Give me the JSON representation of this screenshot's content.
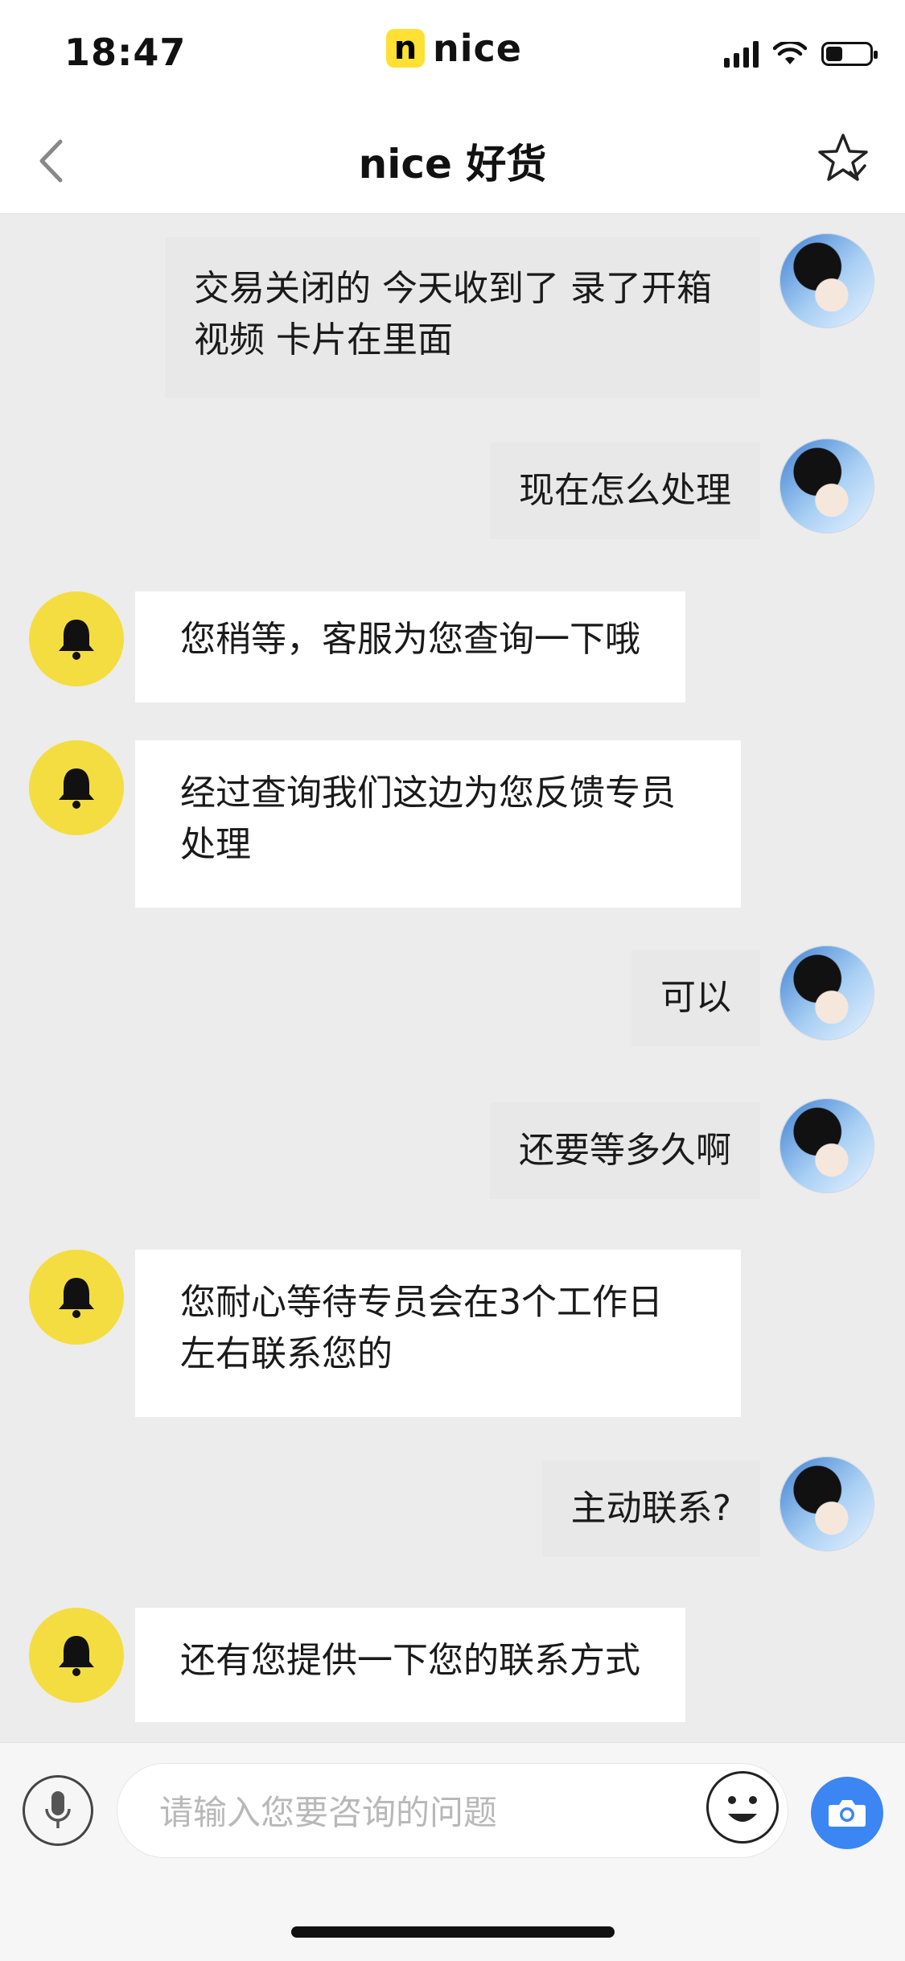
{
  "status_bar": {
    "time": "18:47",
    "brand_badge": "n",
    "brand_name": "nice"
  },
  "nav": {
    "title": "nice 好货",
    "back_icon": "chevron-left-icon",
    "star_icon": "star-icon"
  },
  "messages": [
    {
      "sender": "user",
      "text": "交易关闭的 今天收到了 录了开箱视频 卡片在里面"
    },
    {
      "sender": "user",
      "text": "现在怎么处理"
    },
    {
      "sender": "bot",
      "text": "您稍等，客服为您查询一下哦"
    },
    {
      "sender": "bot",
      "text": "经过查询我们这边为您反馈专员处理"
    },
    {
      "sender": "user",
      "text": "可以"
    },
    {
      "sender": "user",
      "text": "还要等多久啊"
    },
    {
      "sender": "bot",
      "text": "您耐心等待专员会在3个工作日左右联系您的"
    },
    {
      "sender": "user",
      "text": "主动联系?"
    },
    {
      "sender": "bot",
      "text": "还有您提供一下您的联系方式"
    }
  ],
  "input_bar": {
    "placeholder": "请输入您要咨询的问题",
    "mic_icon": "microphone-icon",
    "emoji_icon": "emoji-icon",
    "camera_icon": "camera-icon"
  },
  "colors": {
    "bot_avatar": "#F4DD40",
    "camera_button": "#3B86F2",
    "chat_background": "#ECECEC"
  }
}
